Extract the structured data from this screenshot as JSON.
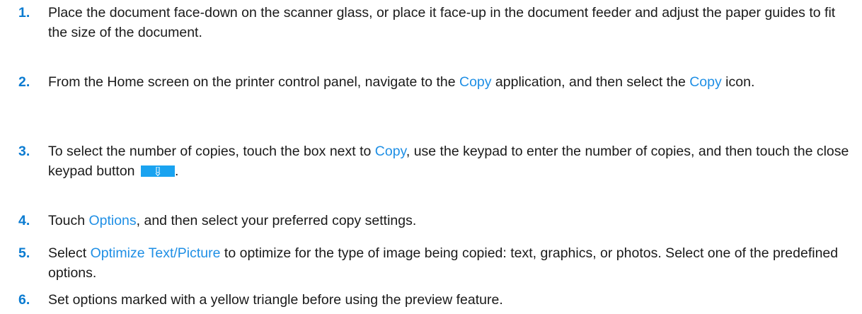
{
  "steps": [
    {
      "number": "1.",
      "text_a": "Place the document face-down on the scanner glass, or place it face-up in the document feeder and adjust the paper guides to fit the size of the document."
    },
    {
      "number": "2.",
      "text_a": "From the Home screen on the printer control panel, navigate to the ",
      "link_a": "Copy",
      "text_b": " application, and then select the ",
      "link_b": "Copy",
      "text_c": " icon."
    },
    {
      "number": "3.",
      "text_a": "To select the number of copies, touch the box next to ",
      "link_a": "Copy",
      "text_b": ", use the keypad to enter the number of copies, and then touch the close keypad button ",
      "icon": "close-keypad-icon",
      "text_c": "."
    },
    {
      "number": "4.",
      "text_a": "Touch ",
      "link_a": "Options",
      "text_b": ", and then select your preferred copy settings."
    },
    {
      "number": "5.",
      "text_a": "Select ",
      "link_a": "Optimize Text/Picture",
      "text_b": " to optimize for the type of image being copied: text, graphics, or photos. Select one of the predefined options."
    },
    {
      "number": "6.",
      "text_a": "Set options marked with a yellow triangle before using the preview feature."
    }
  ],
  "colors": {
    "number": "#0a7bd1",
    "link": "#1f8fe5",
    "keypad_button": "#1aa3f0"
  }
}
